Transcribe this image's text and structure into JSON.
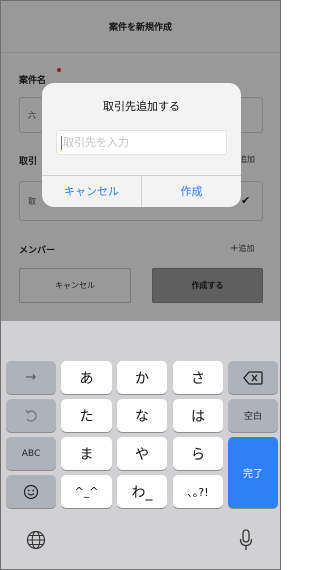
{
  "header": {
    "title": "案件を新規作成"
  },
  "form": {
    "project_name_label": "案件名",
    "project_name_value": "六",
    "client_label": "取引",
    "client_value": "取",
    "client_add_link": "追加",
    "members_label": "メンバー",
    "members_add_link": "追加",
    "cancel_label": "キャンセル",
    "create_label": "作成する"
  },
  "alert": {
    "title": "取引先追加する",
    "input_placeholder": "取引先を入力",
    "input_value": "",
    "cancel_label": "キャンセル",
    "ok_label": "作成"
  },
  "keyboard": {
    "keys": {
      "a": "あ",
      "ka": "か",
      "sa": "さ",
      "ta": "た",
      "na": "な",
      "ha": "は",
      "ma": "ま",
      "ya": "や",
      "ra": "ら",
      "dakuten": "^_^",
      "wa": "わ_",
      "punct": "､｡?!"
    },
    "abc_label": "ABC",
    "space_label": "空白",
    "done_label": "完了",
    "next_arrow": "→"
  }
}
